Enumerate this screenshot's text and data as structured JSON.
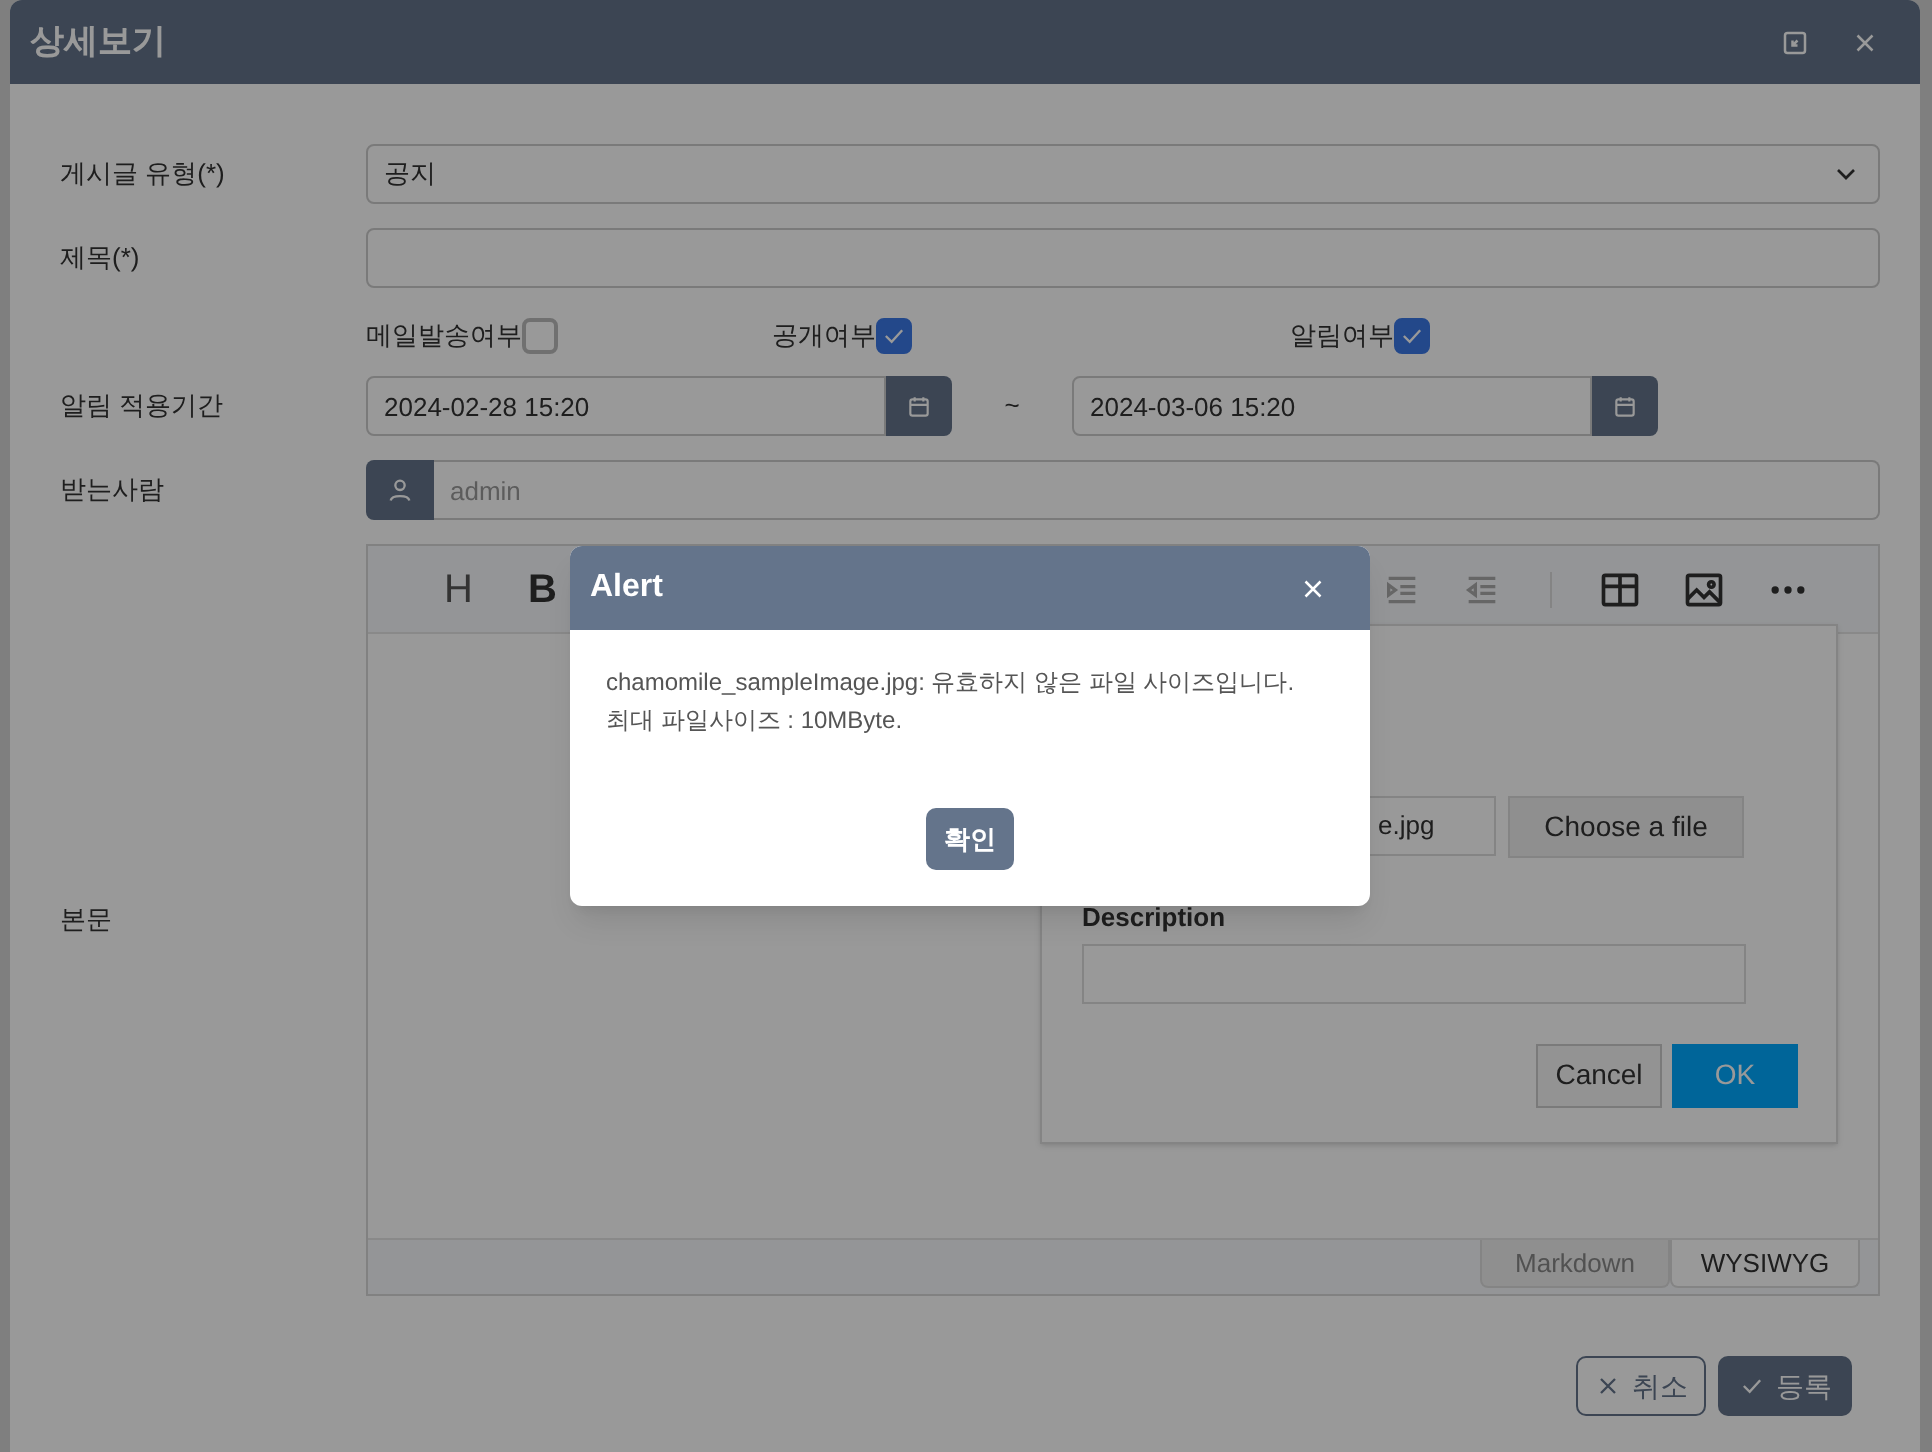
{
  "dialog": {
    "title": "상세보기"
  },
  "form": [
    {
      "kind": "select",
      "label": "게시글 유형(*)",
      "value": "공지"
    },
    {
      "kind": "text",
      "label": "제목(*)"
    },
    {
      "kind": "checkboxes",
      "options": [
        {
          "label": "메일발송여부",
          "checked": false
        },
        {
          "label": "공개여부",
          "checked": true
        },
        {
          "label": "알림여부",
          "checked": true
        }
      ]
    },
    {
      "kind": "daterange",
      "label": "알림 적용기간",
      "start": "2024-02-28 15:20",
      "separator": "~",
      "end": "2024-03-06 15:20"
    },
    {
      "kind": "recipient",
      "label": "받는사람",
      "placeholder": "admin"
    },
    {
      "kind": "editor",
      "label": "본문"
    }
  ],
  "editor": {
    "toolbar_glyphs": [
      "H",
      "B"
    ],
    "image_popup": {
      "file_value": "e.jpg",
      "choose_button": "Choose a file",
      "description_label": "Description",
      "cancel": "Cancel",
      "ok": "OK"
    },
    "mode_tabs": [
      {
        "label": "Markdown",
        "selected": false
      },
      {
        "label": "WYSIWYG",
        "selected": true
      }
    ]
  },
  "footer_buttons": [
    {
      "kind": "cancel",
      "label": "취소"
    },
    {
      "kind": "submit",
      "label": "등록"
    }
  ],
  "alert": {
    "title": "Alert",
    "message": [
      "chamomile_sampleImage.jpg: 유효하지 않은 파일 사이즈입니다.",
      "최대 파일사이즈 : 10MByte."
    ],
    "button": "확인"
  }
}
